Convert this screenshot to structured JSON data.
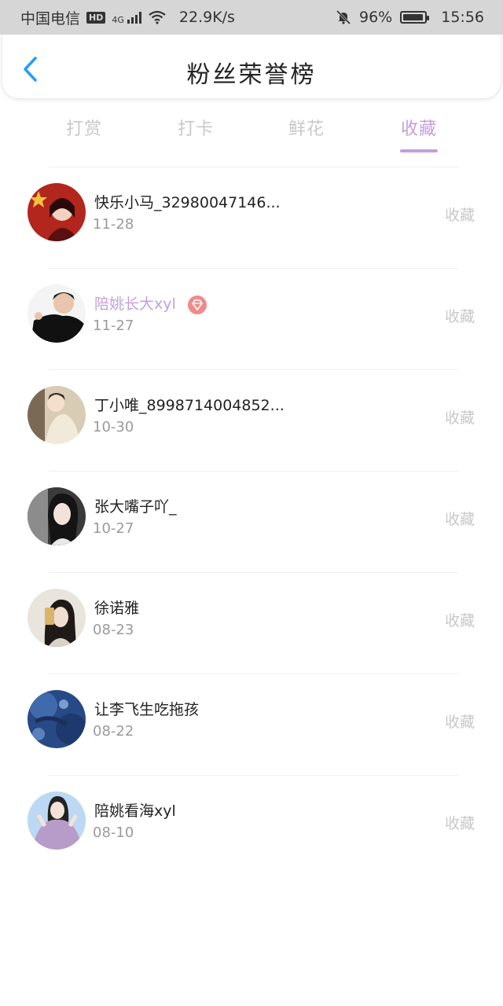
{
  "status_bar": {
    "carrier": "中国电信",
    "hd": "HD",
    "network": "4G",
    "speed": "22.9K/s",
    "battery": "96%",
    "battery_level": 0.96,
    "time": "15:56"
  },
  "header": {
    "title": "粉丝荣誉榜"
  },
  "tabs": [
    {
      "label": "打赏",
      "active": false
    },
    {
      "label": "打卡",
      "active": false
    },
    {
      "label": "鲜花",
      "active": false
    },
    {
      "label": "收藏",
      "active": true
    }
  ],
  "colors": {
    "accent": "#c49fdc",
    "back_arrow": "#2a9df4",
    "muted": "#c8c8c8"
  },
  "fans": [
    {
      "name": "快乐小马_32980047146...",
      "date": "11-28",
      "action": "收藏",
      "vip": false
    },
    {
      "name": "陪姚长大xyl",
      "date": "11-27",
      "action": "收藏",
      "vip": true
    },
    {
      "name": "丁小唯_8998714004852...",
      "date": "10-30",
      "action": "收藏",
      "vip": false
    },
    {
      "name": "张大嘴子吖_",
      "date": "10-27",
      "action": "收藏",
      "vip": false
    },
    {
      "name": "徐诺雅",
      "date": "08-23",
      "action": "收藏",
      "vip": false
    },
    {
      "name": "让李飞生吃拖孩",
      "date": "08-22",
      "action": "收藏",
      "vip": false
    },
    {
      "name": "陪姚看海xyl",
      "date": "08-10",
      "action": "收藏",
      "vip": false
    }
  ]
}
